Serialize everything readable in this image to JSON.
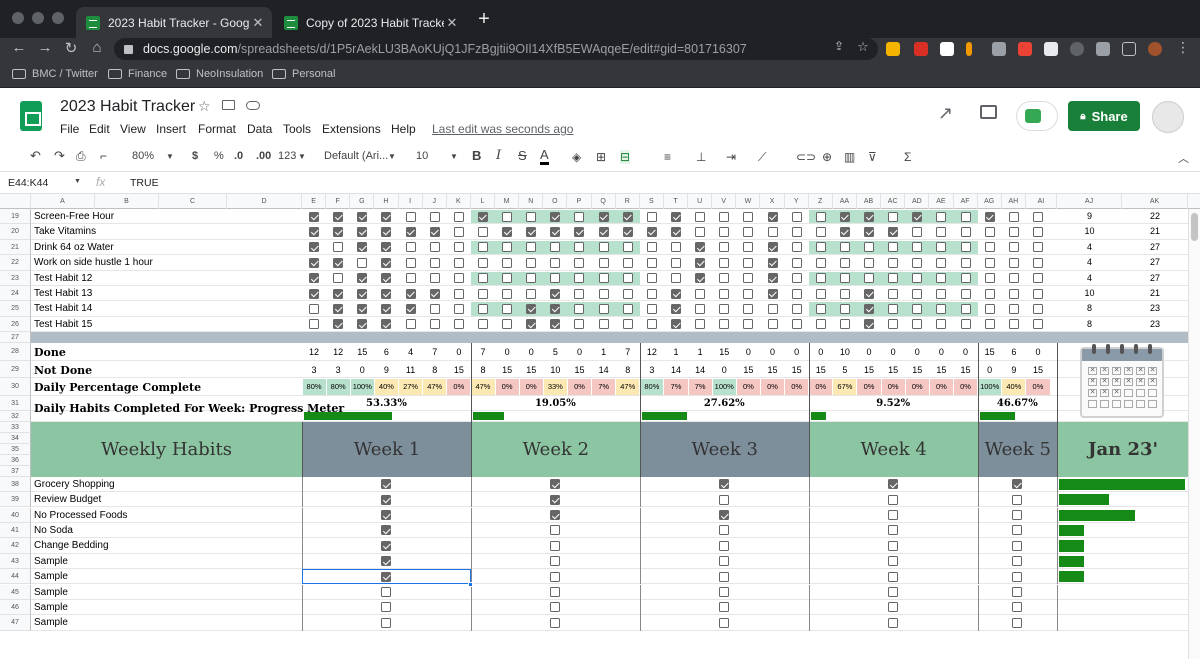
{
  "browser": {
    "tabs": [
      {
        "title": "2023 Habit Tracker - Google Sh",
        "active": true
      },
      {
        "title": "Copy of 2023 Habit Tracker - G",
        "active": false
      }
    ],
    "url_domain": "docs.google.com",
    "url_path": "/spreadsheets/d/1P5rAekLU3BAoKUjQ1JFzBgjtii9OIl14XfB5EWAqqeE/edit#gid=801716307",
    "bookmarks": [
      "BMC / Twitter",
      "Finance",
      "NeoInsulation",
      "Personal"
    ]
  },
  "sheet": {
    "title": "2023 Habit Tracker",
    "menu": [
      "File",
      "Edit",
      "View",
      "Insert",
      "Format",
      "Data",
      "Tools",
      "Extensions",
      "Help"
    ],
    "last_edit": "Last edit was seconds ago",
    "share_label": "Share"
  },
  "toolbar": {
    "zoom": "80%",
    "currency": "$",
    "percent": "%",
    "dec_less": ".0",
    "dec_more": ".00",
    "format": "123",
    "font": "Default (Ari...",
    "font_size": "10",
    "bold": "B",
    "italic": "I",
    "strike": "S",
    "textcolor": "A"
  },
  "formula_bar": {
    "name_box": "E44:K44",
    "fx": "fx",
    "value": "TRUE"
  },
  "columns": [
    "A",
    "B",
    "C",
    "D",
    "E",
    "F",
    "G",
    "H",
    "I",
    "J",
    "K",
    "L",
    "M",
    "N",
    "O",
    "P",
    "Q",
    "R",
    "S",
    "T",
    "U",
    "V",
    "W",
    "X",
    "Y",
    "Z",
    "AA",
    "AB",
    "AC",
    "AD",
    "AE",
    "AF",
    "AG",
    "AH",
    "AI",
    "AJ",
    "AK"
  ],
  "daily_habits": [
    {
      "row": "19",
      "name": "Screen-Free Hour",
      "checks": "11110001001011010001001101001001000",
      "done": "9",
      "not_done": "22"
    },
    {
      "row": "20",
      "name": "Take Vitamins",
      "checks": "11111100111111110000001110000001000",
      "done": "10",
      "not_done": "21"
    },
    {
      "row": "21",
      "name": "Drink 64 oz Water",
      "checks": "10110000000000001001000000000001000",
      "done": "4",
      "not_done": "27"
    },
    {
      "row": "22",
      "name": "Work on side hustle 1 hour",
      "checks": "11010000000000001001000000000001000",
      "done": "4",
      "not_done": "27"
    },
    {
      "row": "23",
      "name": "Test Habit 12",
      "checks": "10110000000000001001000000000001000",
      "done": "4",
      "not_done": "27"
    },
    {
      "row": "24",
      "name": "Test Habit 13",
      "checks": "11111100001000010001000100000001100",
      "done": "10",
      "not_done": "21"
    },
    {
      "row": "25",
      "name": "Test Habit 14",
      "checks": "01111000011000010000000100000001100",
      "done": "8",
      "not_done": "23"
    },
    {
      "row": "26",
      "name": "Test Habit 15",
      "checks": "01110000011000010000000100000001100",
      "done": "8",
      "not_done": "23"
    }
  ],
  "summary": {
    "done_label": "Done",
    "not_done_label": "Not Done",
    "pct_label": "Daily Percentage Complete",
    "meter_label": "Daily Habits Completed For Week: Progress Meter",
    "done": [
      "12",
      "12",
      "15",
      "6",
      "4",
      "7",
      "0",
      "7",
      "0",
      "0",
      "5",
      "0",
      "1",
      "7",
      "12",
      "1",
      "1",
      "15",
      "0",
      "0",
      "0",
      "0",
      "10",
      "0",
      "0",
      "0",
      "0",
      "0",
      "15",
      "6",
      "0"
    ],
    "not_done": [
      "3",
      "3",
      "0",
      "9",
      "11",
      "8",
      "15",
      "8",
      "15",
      "15",
      "10",
      "15",
      "14",
      "8",
      "3",
      "14",
      "14",
      "0",
      "15",
      "15",
      "15",
      "15",
      "5",
      "15",
      "15",
      "15",
      "15",
      "15",
      "0",
      "9",
      "15"
    ],
    "pct": [
      "80%",
      "80%",
      "100%",
      "40%",
      "27%",
      "47%",
      "0%",
      "47%",
      "0%",
      "0%",
      "33%",
      "0%",
      "7%",
      "47%",
      "80%",
      "7%",
      "7%",
      "100%",
      "0%",
      "0%",
      "0%",
      "0%",
      "67%",
      "0%",
      "0%",
      "0%",
      "0%",
      "0%",
      "100%",
      "40%",
      "0%"
    ],
    "week_pct": [
      {
        "label": "53.33%",
        "value": 0.5333
      },
      {
        "label": "19.05%",
        "value": 0.1905
      },
      {
        "label": "27.62%",
        "value": 0.2762
      },
      {
        "label": "9.52%",
        "value": 0.0952
      },
      {
        "label": "46.67%",
        "value": 0.4667
      }
    ]
  },
  "weekly": {
    "title": "Weekly Habits",
    "weeks": [
      "Week 1",
      "Week 2",
      "Week 3",
      "Week 4",
      "Week 5"
    ],
    "month": "Jan 23'",
    "habits": [
      {
        "row": "38",
        "name": "Grocery Shopping",
        "checks": "11111",
        "month_progress": 1.0
      },
      {
        "row": "39",
        "name": "Review Budget",
        "checks": "11000",
        "month_progress": 0.4
      },
      {
        "row": "40",
        "name": "No Processed Foods",
        "checks": "11100",
        "month_progress": 0.6
      },
      {
        "row": "41",
        "name": "No Soda",
        "checks": "10000",
        "month_progress": 0.2
      },
      {
        "row": "42",
        "name": "Change Bedding",
        "checks": "10000",
        "month_progress": 0.2
      },
      {
        "row": "43",
        "name": "Sample",
        "checks": "10000",
        "month_progress": 0.2
      },
      {
        "row": "44",
        "name": "Sample",
        "checks": "10000",
        "month_progress": 0.2
      },
      {
        "row": "45",
        "name": "Sample",
        "checks": "00000",
        "month_progress": 0
      },
      {
        "row": "46",
        "name": "Sample",
        "checks": "00000",
        "month_progress": 0
      },
      {
        "row": "47",
        "name": "Sample",
        "checks": "00000",
        "month_progress": 0
      }
    ]
  },
  "colors": {
    "green_band": "#b7e1cd",
    "week_odd": "#7e8f9c",
    "week_even": "#8cc5a2",
    "pct_green": "#b7e1cd",
    "pct_yellow": "#fce8b2",
    "pct_red": "#f4c7c3",
    "bar": "#168a16",
    "share": "#188038"
  }
}
